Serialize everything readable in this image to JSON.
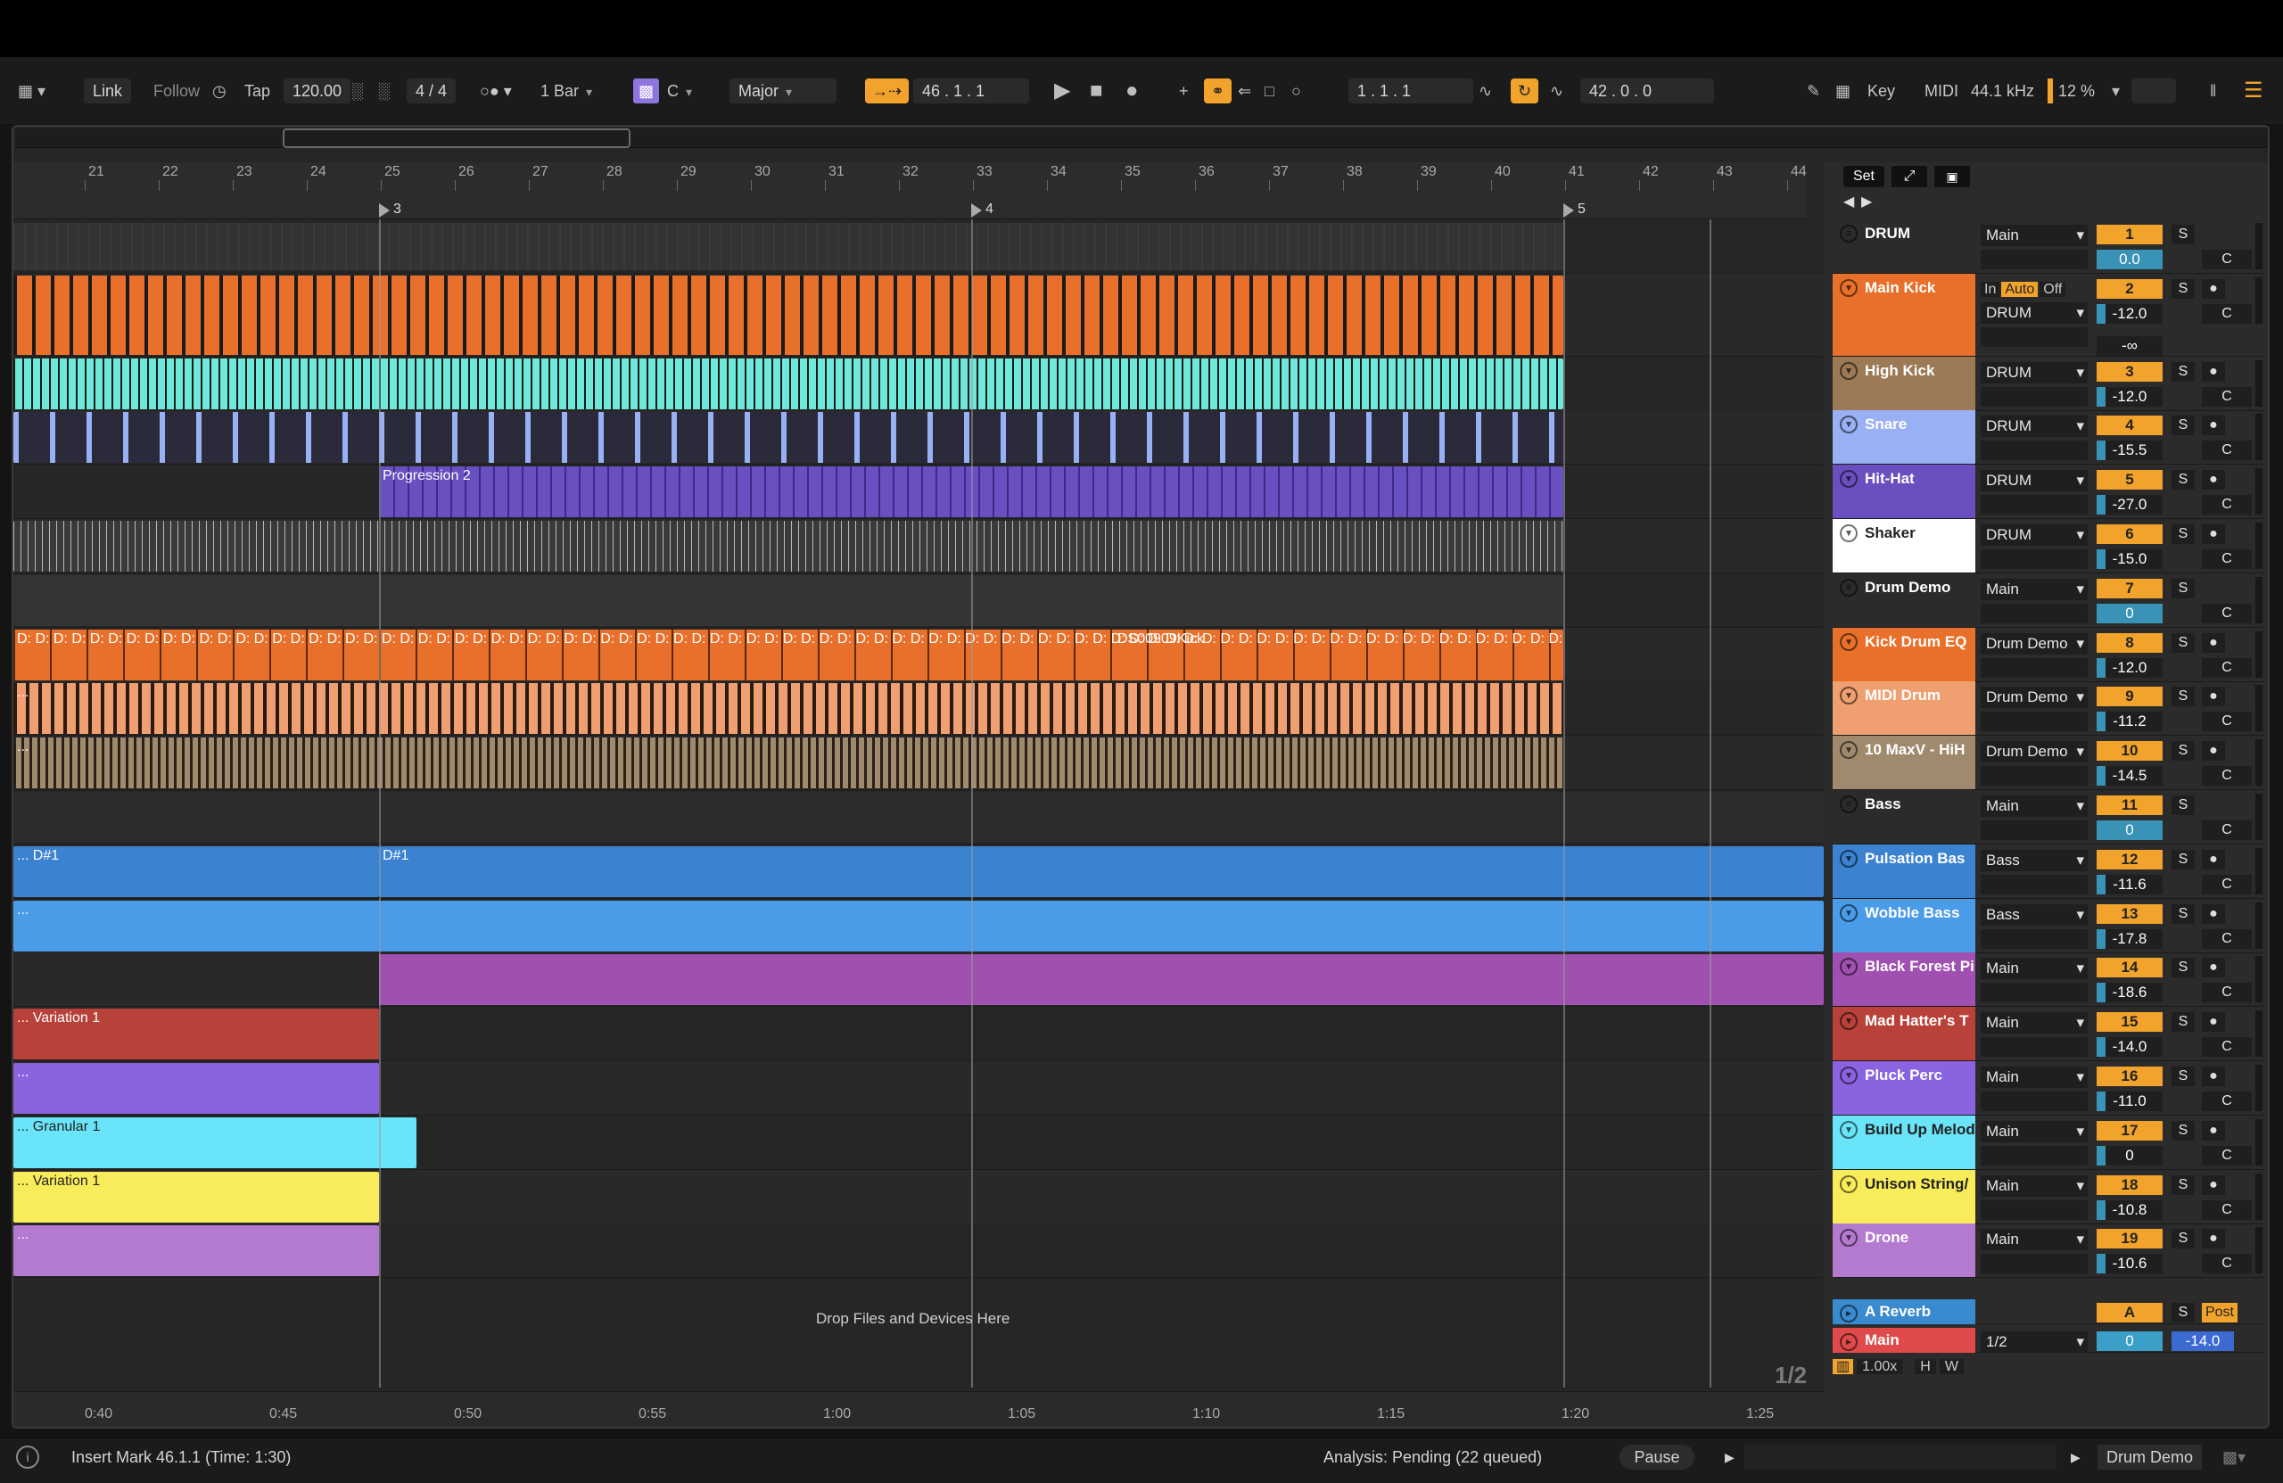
{
  "transport": {
    "link": "Link",
    "follow": "Follow",
    "tap": "Tap",
    "tempo": "120.00",
    "time_signature": "4 / 4",
    "quantize": "1 Bar",
    "scale_root": "C",
    "scale_mode": "Major",
    "position": "46 .   1 .   1",
    "loop_start": "1 .   1 .   1",
    "loop_length": "42 .   0 .   0",
    "key": "Key",
    "midi": "MIDI",
    "sample_rate": "44.1 kHz",
    "cpu": "12 %"
  },
  "ruler": {
    "bars": [
      "21",
      "22",
      "23",
      "24",
      "25",
      "26",
      "27",
      "28",
      "29",
      "30",
      "31",
      "32",
      "33",
      "34",
      "35",
      "36",
      "37",
      "38",
      "39",
      "40",
      "41",
      "42",
      "43",
      "44"
    ],
    "locators": [
      "3",
      "4",
      "5"
    ],
    "set_button": "Set"
  },
  "time_axis": [
    "0:40",
    "0:45",
    "0:50",
    "0:55",
    "1:00",
    "1:05",
    "1:10",
    "1:15",
    "1:20",
    "1:25"
  ],
  "clips": {
    "progression": "Progression 2",
    "kick_samples": "D: D: D: D: D: D: D: D: D: D: D: D: D: D: D: D: D: D: D: D: D: D: D: D: D: D: D: D: D: D: D: D: D: D: D: D: D: D: D: D: D: D: D: D: D: D: D: D: D: D: D: D: D: D: D: D: D: D: D: D: D: D: D: D: D: D: D: D: D: D: D: D: D: D: D: D: D: D: D: D: D: D: D: D: D: D: D: D:",
    "kick_name": "DS00909Kick",
    "dots": "...",
    "pulsation_a": "... D#1",
    "pulsation_b": "D#1",
    "variation_a": "... Variation 1",
    "granular": "... Granular 1",
    "variation_b": "... Variation 1",
    "drop_message": "Drop Files and Devices Here",
    "page_indicator": "1/2"
  },
  "tracks": [
    {
      "name": "DRUM",
      "color": "#3d3d3d",
      "route": "Main",
      "num": "1",
      "vol": "0.0",
      "group": true
    },
    {
      "name": "Main Kick",
      "color": "#e8702a",
      "route": "DRUM",
      "num": "2",
      "vol": "-12.0",
      "in": "In",
      "auto": "Auto",
      "off": "Off",
      "extra": "-∞"
    },
    {
      "name": "High Kick",
      "color": "#9c7a56",
      "route": "DRUM",
      "num": "3",
      "vol": "-12.0"
    },
    {
      "name": "Snare",
      "color": "#9ab0f5",
      "route": "DRUM",
      "num": "4",
      "vol": "-15.5"
    },
    {
      "name": "Hit-Hat",
      "color": "#6a4fc0",
      "route": "DRUM",
      "num": "5",
      "vol": "-27.0"
    },
    {
      "name": "Shaker",
      "color": "#ffffff",
      "route": "DRUM",
      "num": "6",
      "vol": "-15.0"
    },
    {
      "name": "Drum Demo",
      "color": "#3d3d3d",
      "route": "Main",
      "num": "7",
      "vol": "0",
      "group": true
    },
    {
      "name": "Kick Drum EQ",
      "color": "#e8702a",
      "route": "Drum Demo",
      "num": "8",
      "vol": "-12.0"
    },
    {
      "name": "MIDI Drum",
      "color": "#f0a070",
      "route": "Drum Demo",
      "num": "9",
      "vol": "-11.2"
    },
    {
      "name": "10 MaxV - HiH",
      "color": "#a08a6e",
      "route": "Drum Demo",
      "num": "10",
      "vol": "-14.5"
    },
    {
      "name": "Bass",
      "color": "#1f3aa8",
      "route": "Main",
      "num": "11",
      "vol": "0",
      "group": true
    },
    {
      "name": "Pulsation Bas",
      "color": "#3b82d0",
      "route": "Bass",
      "num": "12",
      "vol": "-11.6"
    },
    {
      "name": "Wobble Bass",
      "color": "#4a9ce8",
      "route": "Bass",
      "num": "13",
      "vol": "-17.8"
    },
    {
      "name": "Black Forest Pi",
      "color": "#a050b0",
      "route": "Main",
      "num": "14",
      "vol": "-18.6"
    },
    {
      "name": "Mad Hatter's T",
      "color": "#b8423a",
      "route": "Main",
      "num": "15",
      "vol": "-14.0"
    },
    {
      "name": "Pluck Perc",
      "color": "#8a64e0",
      "route": "Main",
      "num": "16",
      "vol": "-11.0"
    },
    {
      "name": "Build Up Melod",
      "color": "#6ae4f8",
      "route": "Main",
      "num": "17",
      "vol": "0"
    },
    {
      "name": "Unison String/",
      "color": "#f8ec5a",
      "route": "Main",
      "num": "18",
      "vol": "-10.8"
    },
    {
      "name": "Drone",
      "color": "#b47ad0",
      "route": "Main",
      "num": "19",
      "vol": "-10.6"
    }
  ],
  "returns": [
    {
      "name": "A Reverb",
      "color": "#3a8ad0",
      "num": "A",
      "post": "Post"
    },
    {
      "name": "Main",
      "color": "#e04a4a",
      "route": "1/2",
      "vol": "0",
      "vol2": "-14.0"
    }
  ],
  "footer_controls": {
    "zoom": "1.00x",
    "h": "H",
    "w": "W"
  },
  "status": {
    "message": "Insert Mark 46.1.1 (Time: 1:30)",
    "analysis": "Analysis: Pending (22 queued)",
    "pause": "Pause",
    "device": "Drum Demo"
  },
  "colors": {
    "accent": "#f2a32b",
    "background": "#262626"
  }
}
